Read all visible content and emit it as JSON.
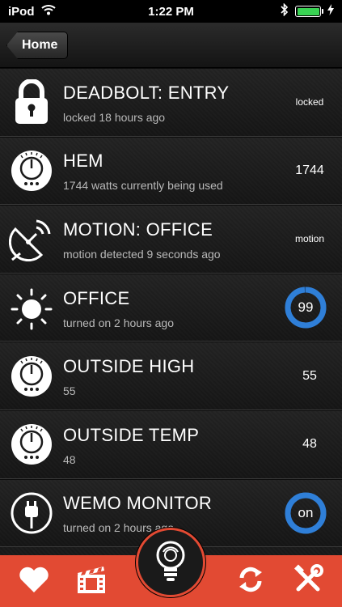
{
  "status_bar": {
    "carrier": "iPod",
    "time": "1:22 PM",
    "battery_color": "#39d353"
  },
  "nav": {
    "back_label": "Home"
  },
  "devices": [
    {
      "title": "DEADBOLT: ENTRY",
      "subtitle": "locked 18 hours ago",
      "value": "locked",
      "icon": "padlock-icon"
    },
    {
      "title": "HEM",
      "subtitle": "1744 watts currently being used",
      "value": "1744",
      "icon": "meter-dial-icon"
    },
    {
      "title": "MOTION: OFFICE",
      "subtitle": "motion detected 9 seconds ago",
      "value": "motion",
      "icon": "motion-sensor-icon"
    },
    {
      "title": "OFFICE",
      "subtitle": "turned on 2 hours ago",
      "value": "99",
      "level": 0.99,
      "icon": "sun-dimmer-icon"
    },
    {
      "title": "OUTSIDE HIGH",
      "subtitle": "55",
      "value": "55",
      "icon": "meter-dial-icon"
    },
    {
      "title": "OUTSIDE TEMP",
      "subtitle": "48",
      "value": "48",
      "icon": "meter-dial-icon"
    },
    {
      "title": "WEMO MONITOR",
      "subtitle": "turned on 2 hours ago",
      "value": "on",
      "level": 1.0,
      "icon": "power-plug-icon"
    }
  ],
  "colors": {
    "accent": "#e24a33",
    "gauge_blue": "#2f7fd8"
  },
  "tabs": [
    {
      "icon": "heart-icon"
    },
    {
      "icon": "clapperboard-icon"
    },
    {
      "icon": "lightbulb-icon"
    },
    {
      "icon": "refresh-icon"
    },
    {
      "icon": "tools-icon"
    }
  ]
}
